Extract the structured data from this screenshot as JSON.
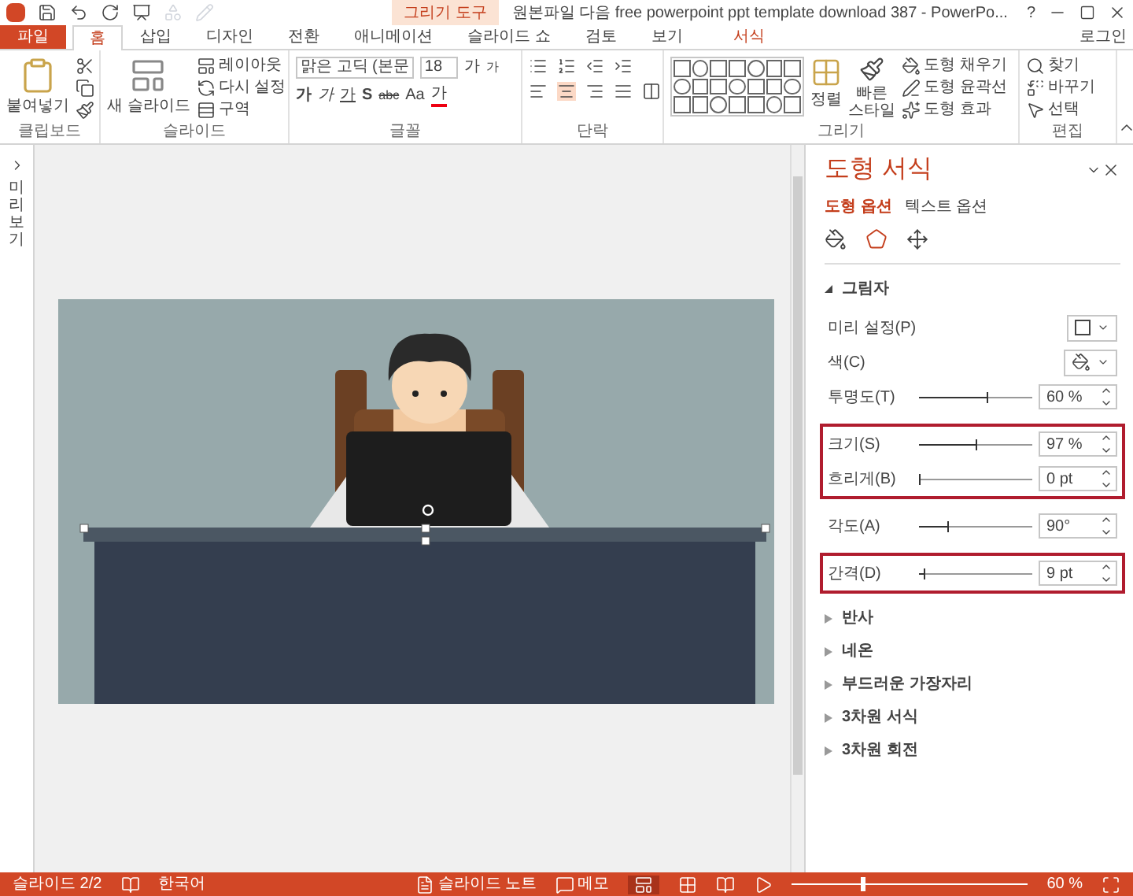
{
  "title_bar": {
    "contextual_label": "그리기 도구",
    "title": "원본파일 다음 free powerpoint ppt template download 387 - PowerPo...",
    "help": "?"
  },
  "tabs": [
    {
      "label": "파일",
      "kind": "file",
      "selected": false
    },
    {
      "label": "홈",
      "kind": "tab",
      "selected": true
    },
    {
      "label": "삽입",
      "kind": "tab",
      "selected": false
    },
    {
      "label": "디자인",
      "kind": "tab",
      "selected": false
    },
    {
      "label": "전환",
      "kind": "tab",
      "selected": false
    },
    {
      "label": "애니메이션",
      "kind": "tab",
      "selected": false
    },
    {
      "label": "슬라이드 쇼",
      "kind": "tab",
      "selected": false
    },
    {
      "label": "검토",
      "kind": "tab",
      "selected": false
    },
    {
      "label": "보기",
      "kind": "tab",
      "selected": false
    },
    {
      "label": "서식",
      "kind": "contextual",
      "selected": false
    }
  ],
  "signin": "로그인",
  "ribbon": {
    "clipboard": {
      "paste": "붙여넣기",
      "label": "클립보드"
    },
    "slides": {
      "new_slide": "새 슬라이드",
      "layout": "레이아웃",
      "reset": "다시 설정",
      "section": "구역",
      "label": "슬라이드"
    },
    "font": {
      "name": "맑은 고딕 (본문",
      "size": "18",
      "grow": "가",
      "shrink": "가",
      "bold": "가",
      "italic": "가",
      "underline": "가",
      "shadow": "S",
      "strike": "abc",
      "case": "Aa",
      "font_color": "가",
      "label": "글꼴"
    },
    "paragraph": {
      "label": "단락"
    },
    "drawing": {
      "arrange": "정렬",
      "quick_styles": "빠른 스타일",
      "fill": "도형 채우기",
      "outline": "도형 윤곽선",
      "effects": "도형 효과",
      "label": "그리기"
    },
    "editing": {
      "find": "찾기",
      "replace": "바꾸기",
      "select": "선택",
      "label": "편집"
    }
  },
  "thumbnails_pane": {
    "label": "미리보기"
  },
  "format_pane": {
    "title": "도형 서식",
    "tabs": [
      {
        "label": "도형 옵션",
        "selected": true
      },
      {
        "label": "텍스트 옵션",
        "selected": false
      }
    ],
    "section": {
      "label": "그림자",
      "expanded": true
    },
    "groups": [
      {
        "highlighted": false,
        "rows": [
          {
            "kind": "preset",
            "label": "미리 설정(P)"
          },
          {
            "kind": "color",
            "label": "색(C)"
          },
          {
            "kind": "slider",
            "label": "투명도(T)",
            "level": 0.6,
            "value": "60 %"
          }
        ]
      },
      {
        "highlighted": true,
        "rows": [
          {
            "kind": "slider",
            "label": "크기(S)",
            "level": 0.5,
            "value": "97 %"
          },
          {
            "kind": "slider",
            "label": "흐리게(B)",
            "level": 0,
            "value": "0 pt"
          }
        ]
      },
      {
        "highlighted": false,
        "rows": [
          {
            "kind": "slider",
            "label": "각도(A)",
            "level": 0.25,
            "value": "90°"
          }
        ]
      },
      {
        "highlighted": true,
        "rows": [
          {
            "kind": "slider",
            "label": "간격(D)",
            "level": 0.04,
            "value": "9 pt"
          }
        ]
      }
    ],
    "collapsed_sections": [
      {
        "label": "반사",
        "expanded": false
      },
      {
        "label": "네온",
        "expanded": false
      },
      {
        "label": "부드러운 가장자리",
        "expanded": false
      },
      {
        "label": "3차원 서식",
        "expanded": false
      },
      {
        "label": "3차원 회전",
        "expanded": false
      }
    ]
  },
  "status_bar": {
    "slide": "슬라이드 2/2",
    "language": "한국어",
    "notes": "슬라이드 노트",
    "comments": "메모",
    "zoom": {
      "level": 0.3,
      "value": "60 %"
    }
  }
}
